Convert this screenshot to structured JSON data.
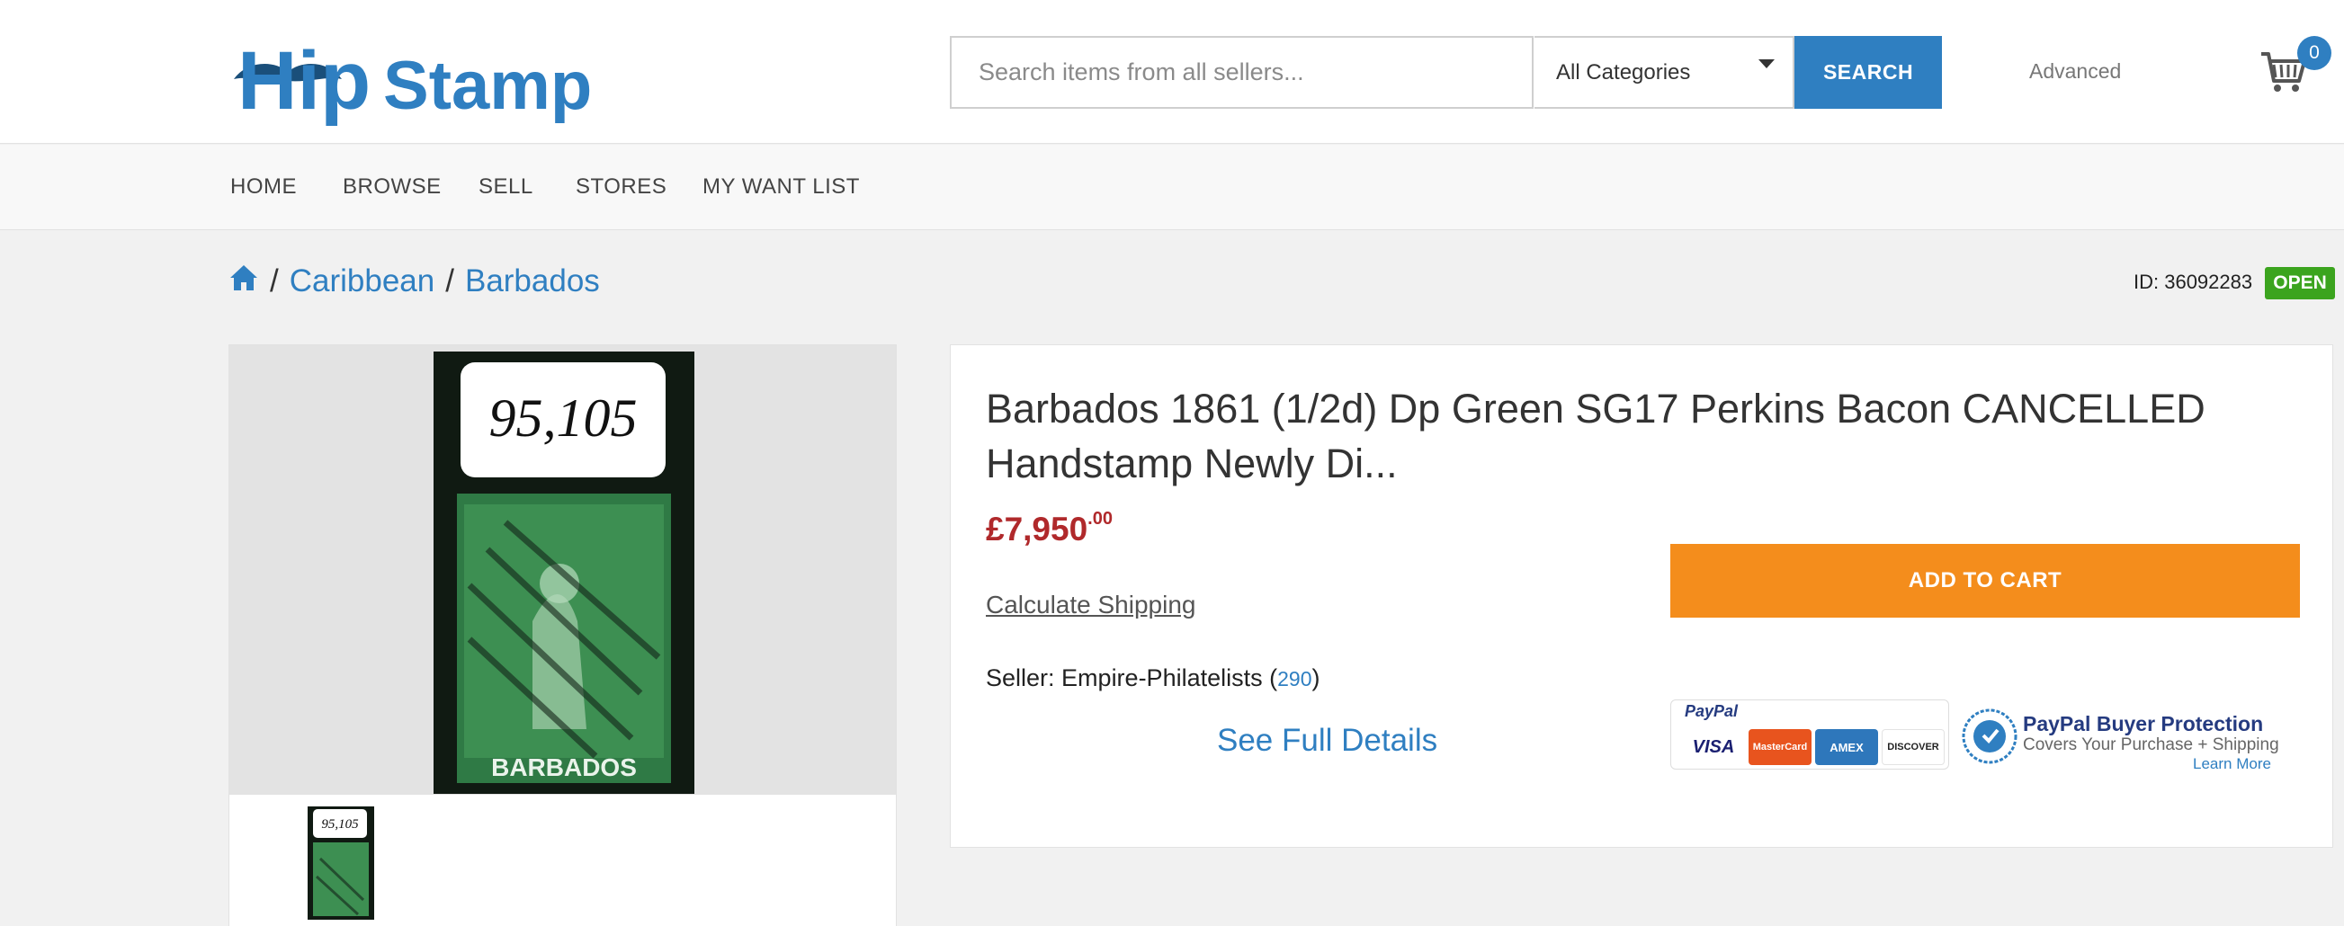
{
  "header": {
    "logo_text": "HipStamp",
    "search": {
      "placeholder": "Search items from all sellers...",
      "value": ""
    },
    "category": "All Categories",
    "search_label": "SEARCH",
    "advanced_label": "Advanced",
    "cart_count": "0",
    "brand_color": "#2f7fc1"
  },
  "nav": {
    "items": [
      {
        "label": "HOME"
      },
      {
        "label": "BROWSE"
      },
      {
        "label": "SELL"
      },
      {
        "label": "STORES"
      },
      {
        "label": "MY WANT LIST"
      }
    ]
  },
  "breadcrumb": {
    "home_icon": "home-icon",
    "items": [
      {
        "label": "Caribbean"
      },
      {
        "label": "Barbados"
      }
    ],
    "separator": "/"
  },
  "listing": {
    "id_text": "ID: 36092283",
    "status": "OPEN",
    "status_color": "#3ba41e",
    "title": "Barbados 1861 (1/2d) Dp Green SG17 Perkins Bacon CANCELLED Handstamp Newly Di...",
    "price_main": "£7,950",
    "price_cents": ".00",
    "price_color": "#b0292b",
    "calculate_shipping": "Calculate Shipping",
    "seller_prefix": "Seller: ",
    "seller_name": "Empire-Philatelists",
    "seller_open": " (",
    "seller_feedback": "290",
    "seller_close": ")",
    "see_full_details": "See Full Details",
    "add_to_cart": "ADD TO CART",
    "add_to_cart_color": "#f48d1c"
  },
  "gallery": {
    "stamp_label": "95,105",
    "stamp_country": "BARBADOS"
  },
  "paypal": {
    "label": "PayPal",
    "cards": [
      "VISA",
      "MasterCard",
      "AMEX",
      "DISCOVER"
    ],
    "title": "PayPal Buyer Protection",
    "subtitle": "Covers Your Purchase + Shipping",
    "learn_more": "Learn More"
  }
}
